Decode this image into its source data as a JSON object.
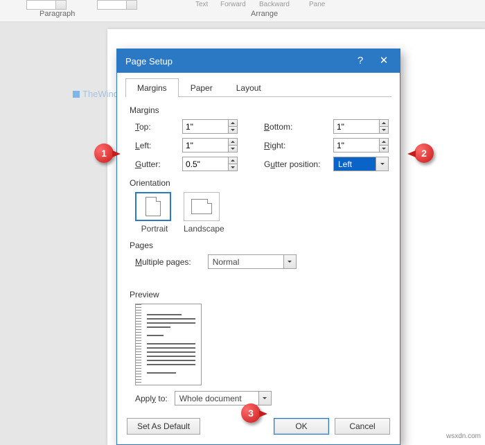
{
  "ribbon": {
    "group_paragraph": "Paragraph",
    "group_arrange": "Arrange",
    "words": {
      "text": "Text",
      "forward": "Forward",
      "backward": "Backward",
      "pane": "Pane"
    }
  },
  "watermark": "TheWindowsClub",
  "dialog": {
    "title": "Page Setup",
    "tabs": {
      "margins": "Margins",
      "paper": "Paper",
      "layout": "Layout"
    },
    "section_margins": "Margins",
    "labels": {
      "top": "Top:",
      "bottom": "Bottom:",
      "left": "Left:",
      "right": "Right:",
      "gutter": "Gutter:",
      "gutter_position": "Gutter position:"
    },
    "values": {
      "top": "1\"",
      "bottom": "1\"",
      "left": "1\"",
      "right": "1\"",
      "gutter": "0.5\"",
      "gutter_position": "Left"
    },
    "section_orientation": "Orientation",
    "orientation": {
      "portrait": "Portrait",
      "landscape": "Landscape"
    },
    "section_pages": "Pages",
    "multiple_pages_label": "Multiple pages:",
    "multiple_pages_value": "Normal",
    "section_preview": "Preview",
    "apply_to_label": "Apply to:",
    "apply_to_value": "Whole document",
    "buttons": {
      "set_default": "Set As Default",
      "ok": "OK",
      "cancel": "Cancel"
    }
  },
  "callouts": {
    "c1": "1",
    "c2": "2",
    "c3": "3"
  },
  "credit": "wsxdn.com"
}
